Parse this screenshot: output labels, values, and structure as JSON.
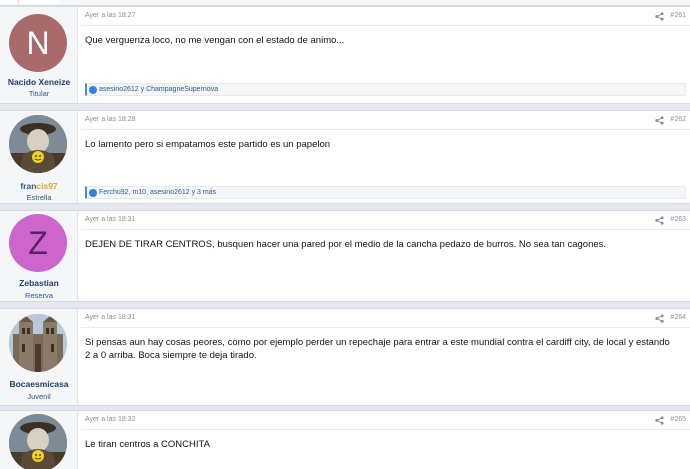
{
  "accent_color": "#2f82d6",
  "posts": [
    {
      "author": "Nacido Xeneize",
      "rank": "Titular",
      "avatar_letter": "N",
      "avatar_color": "#a86a6a",
      "timestamp": "Ayer a las 18:27",
      "post_number": "#261",
      "message": "Que verguenza loco, no me vengan con el estado de animo...",
      "likes": "asesino2612 y ChampagneSupernova"
    },
    {
      "author_part1": "fran",
      "author_part2": "cis97",
      "rank": "Estrella",
      "avatar_icon": "watchmen-smiley-avatar-icon",
      "timestamp": "Ayer a las 18:28",
      "post_number": "#262",
      "message": "Lo lamento pero si empatamos este partido es un papelon",
      "likes": "Ferchu92, m10, asesino2612 y 3 más"
    },
    {
      "author": "Zebastian",
      "rank": "Reserva",
      "avatar_letter": "Z",
      "avatar_color": "#cc66cc",
      "timestamp": "Ayer a las 18:31",
      "post_number": "#263",
      "message": "DEJEN DE TIRAR CENTROS, busquen hacer una pared por el medio de la cancha pedazo de burros. No sea tan cagones."
    },
    {
      "author": "Bocaesmicasa",
      "rank": "Juvenil",
      "avatar_icon": "building-photo-avatar-icon",
      "timestamp": "Ayer a las 18:31",
      "post_number": "#264",
      "message": "Si pensas aun hay cosas peores, como por ejemplo perder un repechaje para entrar a este mundial contra el cardiff city, de local y estando 2 a 0 arriba. Boca siempre te deja tirado."
    },
    {
      "avatar_icon": "watchmen-smiley-avatar-icon",
      "timestamp": "Ayer a las 18:32",
      "post_number": "#265",
      "message": "Le tiran centros a CONCHITA"
    }
  ]
}
